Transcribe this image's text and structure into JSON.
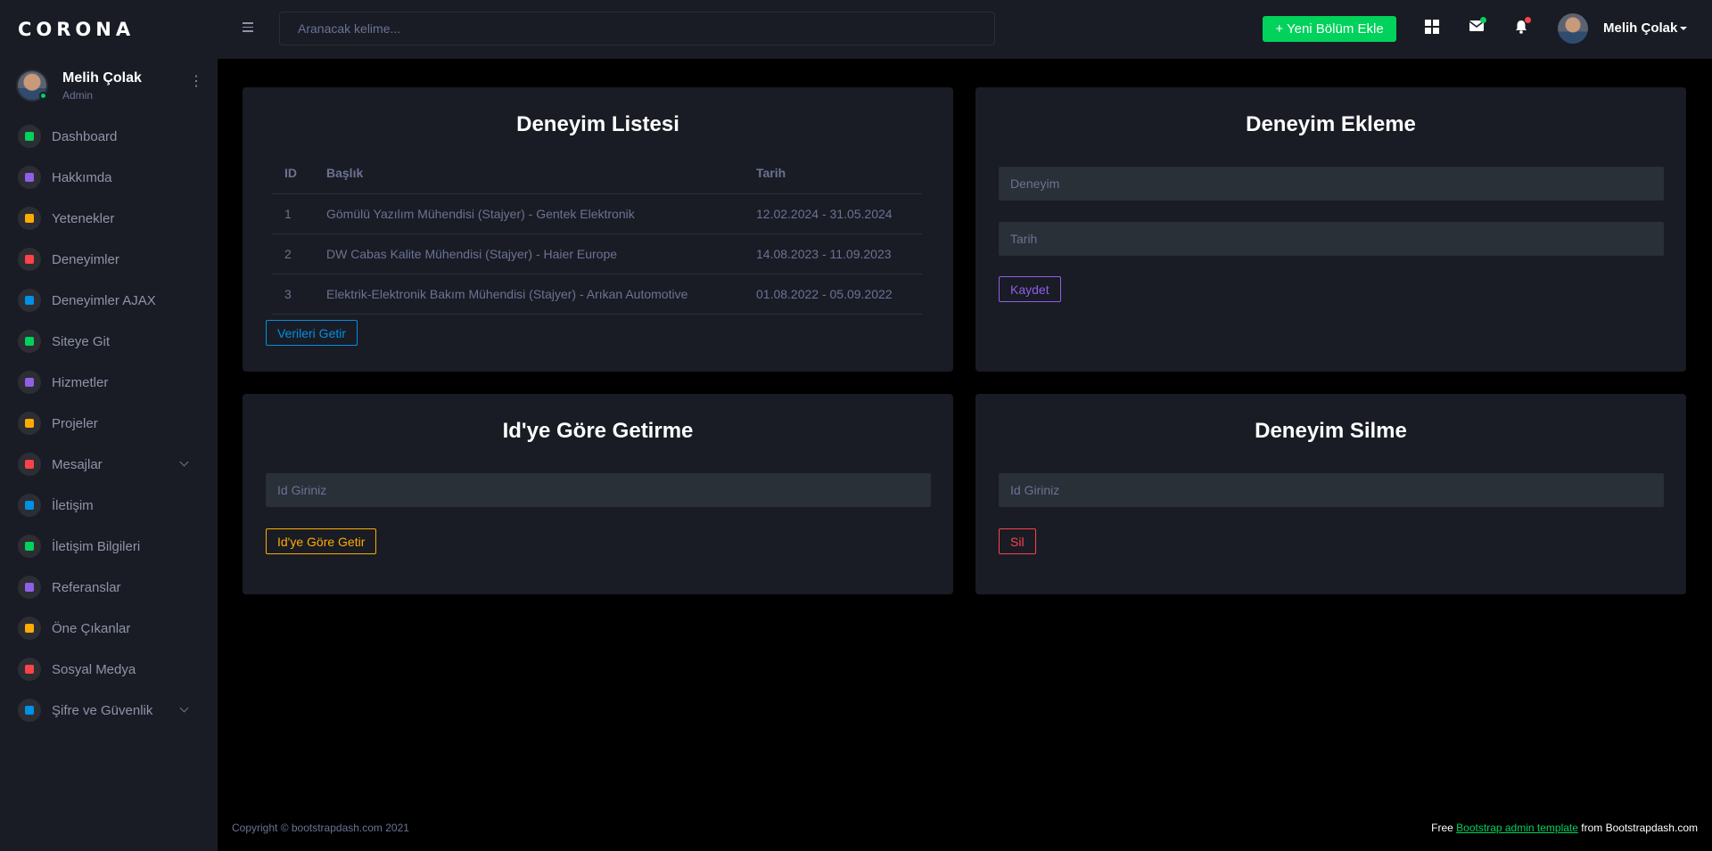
{
  "brand": "CORONA",
  "profile": {
    "name": "Melih Çolak",
    "role": "Admin"
  },
  "sidebar": {
    "items": [
      {
        "label": "Dashboard",
        "icon": "dashboard-icon",
        "color": "#00d25b"
      },
      {
        "label": "Hakkımda",
        "icon": "account-circle-icon",
        "color": "#8f5fe8"
      },
      {
        "label": "Yetenekler",
        "icon": "flash-icon",
        "color": "#ffab00"
      },
      {
        "label": "Deneyimler",
        "icon": "briefcase-icon",
        "color": "#fc424a"
      },
      {
        "label": "Deneyimler AJAX",
        "icon": "briefcase-blue-icon",
        "color": "#0090e7"
      },
      {
        "label": "Siteye Git",
        "icon": "globe-icon",
        "color": "#00d25b"
      },
      {
        "label": "Hizmetler",
        "icon": "settings-icon",
        "color": "#8f5fe8"
      },
      {
        "label": "Projeler",
        "icon": "folder-icon",
        "color": "#ffab00"
      },
      {
        "label": "Mesajlar",
        "icon": "mail-icon",
        "color": "#fc424a",
        "expandable": true
      },
      {
        "label": "İletişim",
        "icon": "phone-icon",
        "color": "#0090e7"
      },
      {
        "label": "İletişim Bilgileri",
        "icon": "phone-green-icon",
        "color": "#00d25b"
      },
      {
        "label": "Referanslar",
        "icon": "thumb-up-icon",
        "color": "#8f5fe8"
      },
      {
        "label": "Öne Çıkanlar",
        "icon": "star-circle-icon",
        "color": "#ffab00"
      },
      {
        "label": "Sosyal Medya",
        "icon": "share-icon",
        "color": "#fc424a"
      },
      {
        "label": "Şifre ve Güvenlik",
        "icon": "lock-icon",
        "color": "#0090e7",
        "expandable": true
      }
    ]
  },
  "navbar": {
    "search_placeholder": "Aranacak kelime...",
    "new_button": "+ Yeni Bölüm Ekle",
    "user_name": "Melih Çolak"
  },
  "list_card": {
    "title": "Deneyim Listesi",
    "columns": [
      "ID",
      "Başlık",
      "Tarih"
    ],
    "rows": [
      [
        "1",
        "Gömülü Yazılım Mühendisi (Stajyer) - Gentek Elektronik",
        "12.02.2024 - 31.05.2024"
      ],
      [
        "2",
        "DW Cabas Kalite Mühendisi (Stajyer) - Haier Europe",
        "14.08.2023 - 11.09.2023"
      ],
      [
        "3",
        "Elektrik-Elektronik Bakım Mühendisi (Stajyer) - Arıkan Automotive",
        "01.08.2022 - 05.09.2022"
      ]
    ],
    "button": "Verileri Getir"
  },
  "add_card": {
    "title": "Deneyim Ekleme",
    "field1_placeholder": "Deneyim",
    "field2_placeholder": "Tarih",
    "button": "Kaydet"
  },
  "get_card": {
    "title": "Id'ye Göre Getirme",
    "placeholder": "Id Giriniz",
    "button": "Id'ye Göre Getir"
  },
  "delete_card": {
    "title": "Deneyim Silme",
    "placeholder": "Id Giriniz",
    "button": "Sil"
  },
  "footer": {
    "copyright": "Copyright © bootstrapdash.com 2021",
    "free": "Free",
    "link": "Bootstrap admin template",
    "from": "from Bootstrapdash.com"
  },
  "colors": {
    "primary": "#0090e7",
    "success": "#00d25b",
    "warning": "#ffab00",
    "danger": "#fc424a",
    "purple": "#8f5fe8",
    "card_bg": "#191c24",
    "page_bg": "#000000"
  }
}
